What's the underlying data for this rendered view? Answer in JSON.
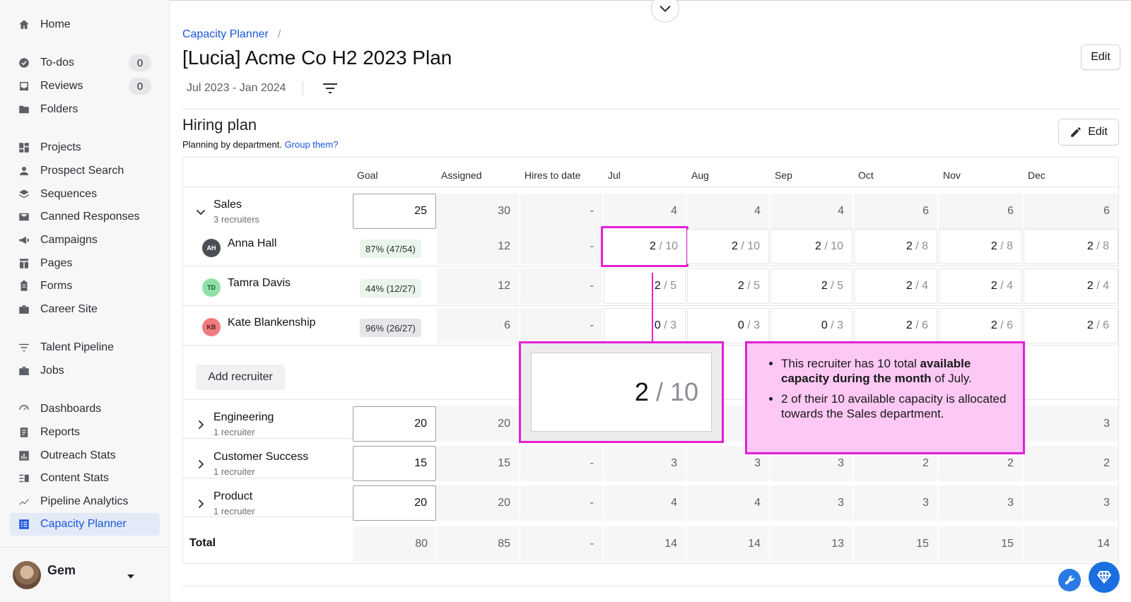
{
  "sidebar": {
    "items": [
      {
        "label": "Home",
        "icon": "home-icon"
      },
      {
        "label": "To-dos",
        "icon": "check-circle-icon",
        "count": "0"
      },
      {
        "label": "Reviews",
        "icon": "inbox-icon",
        "count": "0"
      },
      {
        "label": "Folders",
        "icon": "folder-icon"
      },
      {
        "label": "Projects",
        "icon": "grid-icon"
      },
      {
        "label": "Prospect Search",
        "icon": "person-icon"
      },
      {
        "label": "Sequences",
        "icon": "layers-icon"
      },
      {
        "label": "Canned Responses",
        "icon": "mail-icon"
      },
      {
        "label": "Campaigns",
        "icon": "megaphone-icon"
      },
      {
        "label": "Pages",
        "icon": "pages-icon"
      },
      {
        "label": "Forms",
        "icon": "clipboard-icon"
      },
      {
        "label": "Career Site",
        "icon": "briefcase-icon"
      },
      {
        "label": "Talent Pipeline",
        "icon": "filter-lines-icon"
      },
      {
        "label": "Jobs",
        "icon": "briefcase-icon"
      },
      {
        "label": "Dashboards",
        "icon": "gauge-icon"
      },
      {
        "label": "Reports",
        "icon": "report-icon"
      },
      {
        "label": "Outreach Stats",
        "icon": "bar-chart-icon"
      },
      {
        "label": "Content Stats",
        "icon": "content-stats-icon"
      },
      {
        "label": "Pipeline Analytics",
        "icon": "trend-icon"
      },
      {
        "label": "Capacity Planner",
        "icon": "planner-icon",
        "active": true
      }
    ],
    "user": {
      "name": "Gem"
    }
  },
  "header": {
    "breadcrumb": "Capacity Planner",
    "breadcrumb_sep": "/",
    "title": "[Lucia] Acme Co H2 2023 Plan",
    "date_range": "Jul 2023 - Jan 2024",
    "edit_label": "Edit"
  },
  "hiring_plan": {
    "title": "Hiring plan",
    "subtitle": "Planning by department.",
    "group_link": "Group them?",
    "edit_label": "Edit",
    "columns": [
      "Goal",
      "Assigned",
      "Hires to date",
      "Jul",
      "Aug",
      "Sep",
      "Oct",
      "Nov",
      "Dec"
    ],
    "departments": [
      {
        "name": "Sales",
        "sub": "3 recruiters",
        "goal": "25",
        "assigned": "30",
        "hires": "-",
        "months": [
          "4",
          "4",
          "4",
          "6",
          "6",
          "6"
        ],
        "recruiters": [
          {
            "initials": "AH",
            "name": "Anna Hall",
            "pct": "87% (47/54)",
            "assigned": "12",
            "hires": "-",
            "months": [
              [
                "2",
                "/ 10"
              ],
              [
                "2",
                "/ 10"
              ],
              [
                "2",
                "/ 10"
              ],
              [
                "2",
                "/ 8"
              ],
              [
                "2",
                "/ 8"
              ],
              [
                "2",
                "/ 8"
              ]
            ]
          },
          {
            "initials": "TD",
            "name": "Tamra Davis",
            "pct": "44% (12/27)",
            "assigned": "12",
            "hires": "-",
            "months": [
              [
                "2",
                "/ 5"
              ],
              [
                "2",
                "/ 5"
              ],
              [
                "2",
                "/ 5"
              ],
              [
                "2",
                "/ 4"
              ],
              [
                "2",
                "/ 4"
              ],
              [
                "2",
                "/ 4"
              ]
            ]
          },
          {
            "initials": "KB",
            "name": "Kate Blankenship",
            "pct": "96% (26/27)",
            "assigned": "6",
            "hires": "-",
            "months": [
              [
                "0",
                "/ 3"
              ],
              [
                "0",
                "/ 3"
              ],
              [
                "0",
                "/ 3"
              ],
              [
                "2",
                "/ 6"
              ],
              [
                "2",
                "/ 6"
              ],
              [
                "2",
                "/ 6"
              ]
            ]
          }
        ]
      },
      {
        "name": "Engineering",
        "sub": "1 recruiter",
        "goal": "20",
        "assigned": "20",
        "hires": "",
        "months": [
          "",
          "",
          "",
          "",
          "",
          "3"
        ]
      },
      {
        "name": "Customer Success",
        "sub": "1 recruiter",
        "goal": "15",
        "assigned": "15",
        "hires": "-",
        "months": [
          "3",
          "3",
          "3",
          "2",
          "2",
          "2"
        ]
      },
      {
        "name": "Product",
        "sub": "1 recruiter",
        "goal": "20",
        "assigned": "20",
        "hires": "-",
        "months": [
          "4",
          "4",
          "3",
          "3",
          "3",
          "3"
        ]
      }
    ],
    "add_recruiter_label": "Add recruiter",
    "total": {
      "label": "Total",
      "goal": "80",
      "assigned": "85",
      "hires": "-",
      "months": [
        "14",
        "14",
        "13",
        "15",
        "15",
        "14"
      ]
    }
  },
  "callout": {
    "zoom_value": "2",
    "zoom_cap": "/ 10",
    "bullet1_pre": "This recruiter has 10 total ",
    "bullet1_bold": "available capacity during the month",
    "bullet1_post": " of July.",
    "bullet2": "2 of their 10 available capacity is allocated towards the Sales department."
  },
  "colors": {
    "accent": "#1a56db",
    "callout_border": "#e41fd6",
    "callout_bg": "#fdc8f4",
    "badge_green": "#e8f5ea",
    "badge_grey": "#e6e6e9"
  }
}
